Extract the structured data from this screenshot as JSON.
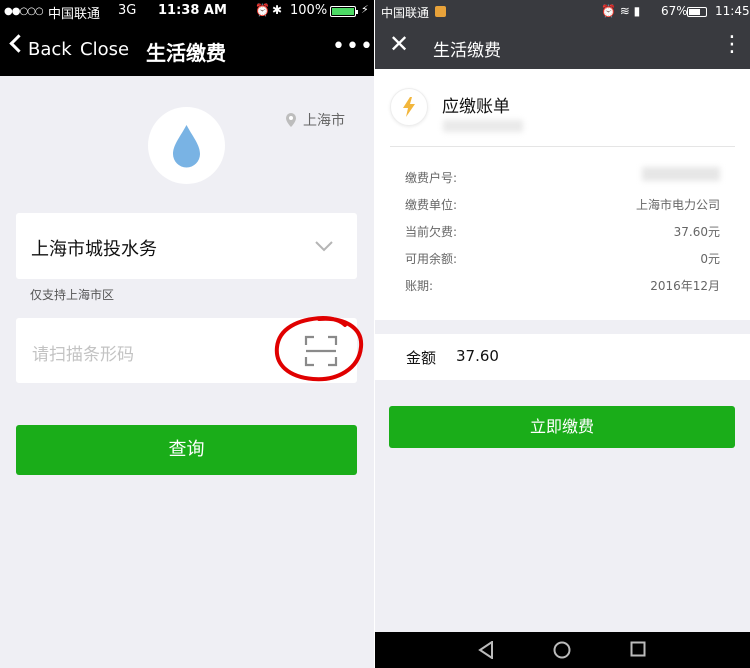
{
  "left": {
    "status": {
      "signal": "●●○○○",
      "carrier": "中国联通",
      "network": "3G",
      "time": "11:38 AM",
      "battery_pct": "100%",
      "battery_level": 1.0
    },
    "nav": {
      "back_label": "Back",
      "close_label": "Close",
      "title": "生活缴费",
      "more_label": "•••"
    },
    "location": "上海市",
    "provider": {
      "value": "上海市城投水务",
      "note": "仅支持上海市区"
    },
    "barcode": {
      "placeholder": "请扫描条形码"
    },
    "query_label": "查询",
    "colors": {
      "accent": "#1aad19",
      "annotation": "#e00000"
    }
  },
  "right": {
    "status": {
      "carrier": "中国联通",
      "battery_pct": "67%",
      "battery_level": 0.67,
      "time": "11:45"
    },
    "nav": {
      "close_label": "✕",
      "title": "生活缴费",
      "more_label": "⋮"
    },
    "bill": {
      "title": "应缴账单",
      "rows": [
        {
          "label": "缴费户号:",
          "value": ""
        },
        {
          "label": "缴费单位:",
          "value": "上海市电力公司"
        },
        {
          "label": "当前欠费:",
          "value": "37.60元"
        },
        {
          "label": "可用余额:",
          "value": "0元"
        },
        {
          "label": "账期:",
          "value": "2016年12月"
        }
      ]
    },
    "amount": {
      "label": "金额",
      "value": "37.60"
    },
    "pay_label": "立即缴费"
  }
}
